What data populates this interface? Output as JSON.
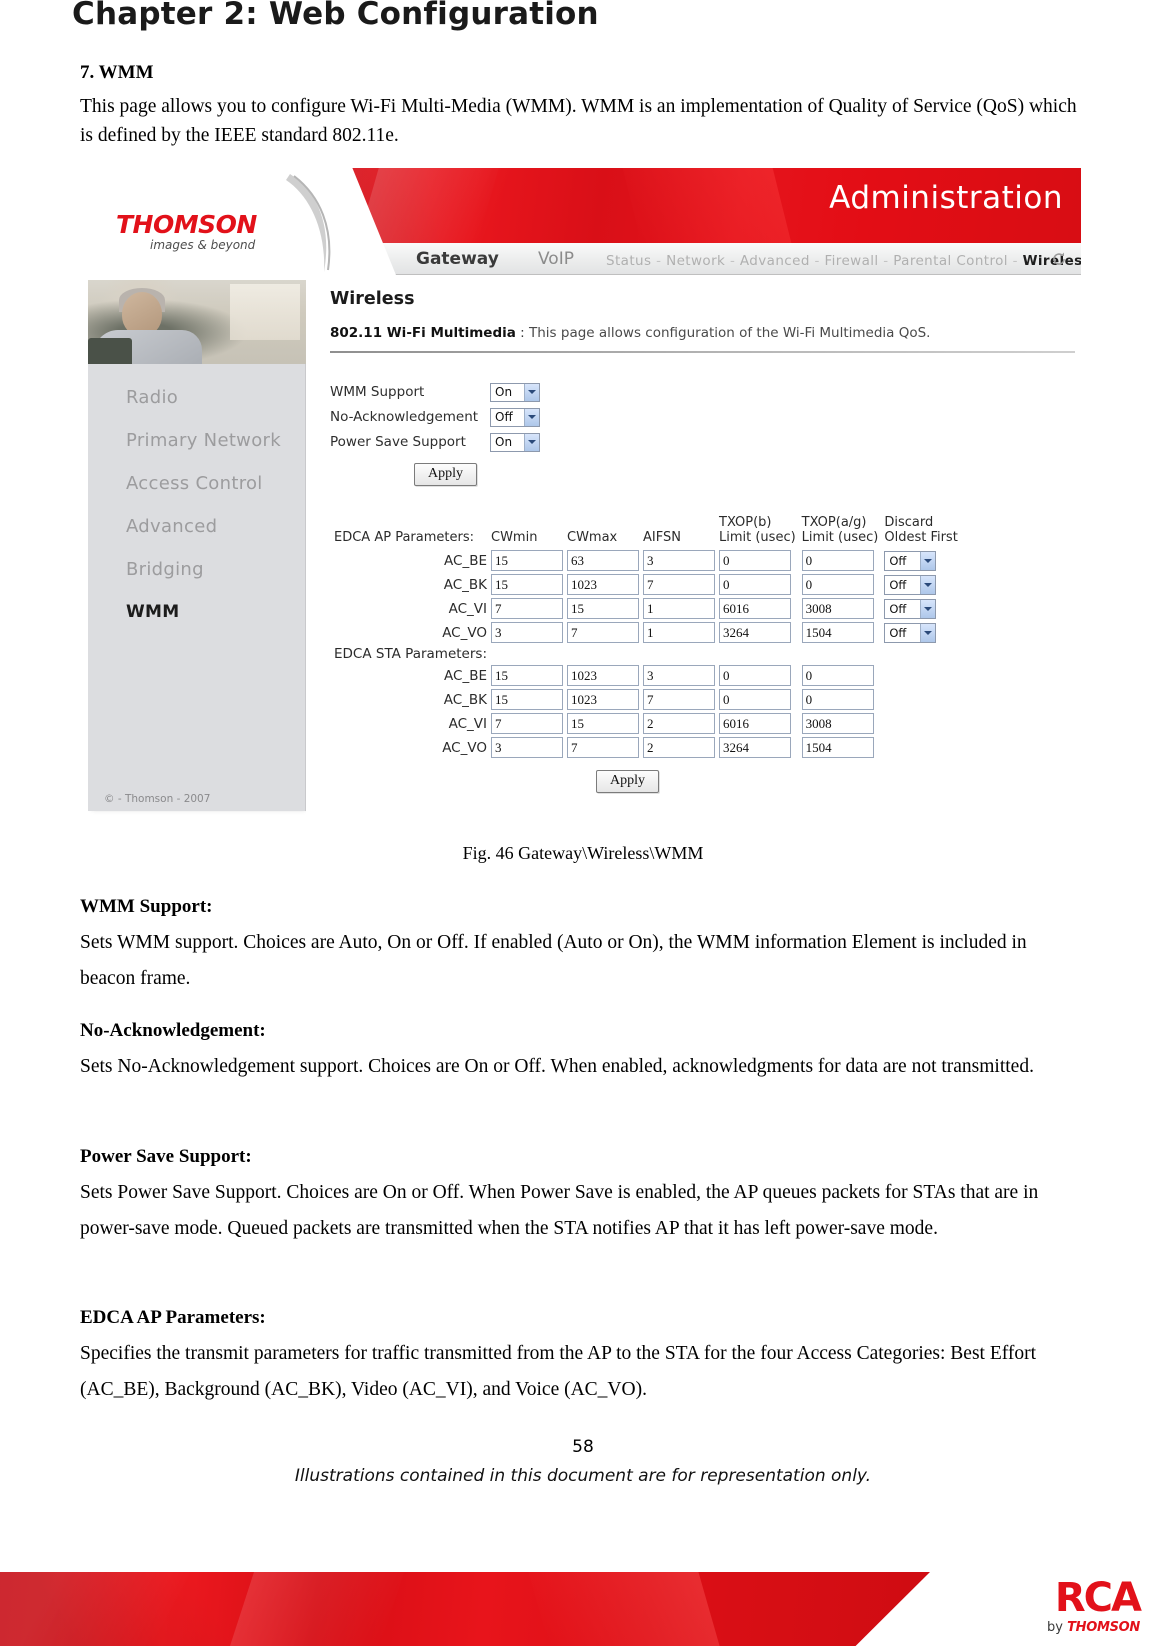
{
  "document": {
    "chapter_title": "Chapter 2: Web Configuration",
    "section_heading": "7. WMM",
    "intro": "This page allows you to configure Wi-Fi Multi-Media (WMM). WMM is an implementation of Quality of Service (QoS) which is defined by the IEEE standard 802.11e.",
    "figure_caption": "Fig. 46 Gateway\\Wireless\\WMM",
    "page_number": "58",
    "footer_note": "Illustrations contained in this document are for representation only."
  },
  "brand": {
    "logo_text": "THOMSON",
    "logo_tagline": "images & beyond",
    "footer_logo": "RCA",
    "footer_logo_by": "by",
    "footer_logo_by_brand": "THOMSON",
    "accent_red": "#e2121b"
  },
  "screenshot": {
    "banner_title": "Administration",
    "nav": {
      "primary": [
        "Gateway",
        "VoIP"
      ],
      "secondary": [
        "Status",
        "Network",
        "Advanced",
        "Firewall",
        "Parental Control",
        "Wireless"
      ],
      "active_secondary": "Wireless",
      "refresh_icon": "refresh-icon"
    },
    "sidebar": {
      "items": [
        "Radio",
        "Primary Network",
        "Access Control",
        "Advanced",
        "Bridging",
        "WMM"
      ],
      "active": "WMM",
      "copyright": "© - Thomson - 2007"
    },
    "pane": {
      "title": "Wireless",
      "subtitle_bold": "802.11 Wi-Fi Multimedia",
      "subtitle_sep": ":",
      "subtitle_desc": "This page allows configuration of the Wi-Fi Multimedia QoS."
    },
    "form": {
      "rows": [
        {
          "label": "WMM Support",
          "value": "On"
        },
        {
          "label": "No-Acknowledgement",
          "value": "Off"
        },
        {
          "label": "Power Save Support",
          "value": "On"
        }
      ],
      "apply_label": "Apply"
    },
    "edca": {
      "ap_title": "EDCA AP Parameters:",
      "sta_title": "EDCA STA Parameters:",
      "headers": [
        "CWmin",
        "CWmax",
        "AIFSN",
        "TXOP(b)\nLimit (usec)",
        "TXOP(a/g)\nLimit (usec)",
        "Discard\nOldest First"
      ],
      "headers_flat": {
        "cwmin": "CWmin",
        "cwmax": "CWmax",
        "aifsn": "AIFSN",
        "txop_b_l1": "TXOP(b)",
        "txop_b_l2": "Limit (usec)",
        "txop_ag_l1": "TXOP(a/g)",
        "txop_ag_l2": "Limit (usec)",
        "discard_l1": "Discard",
        "discard_l2": "Oldest First"
      },
      "ap_rows": [
        {
          "ac": "AC_BE",
          "cwmin": "15",
          "cwmax": "63",
          "aifsn": "3",
          "txop_b": "0",
          "txop_ag": "0",
          "discard": "Off"
        },
        {
          "ac": "AC_BK",
          "cwmin": "15",
          "cwmax": "1023",
          "aifsn": "7",
          "txop_b": "0",
          "txop_ag": "0",
          "discard": "Off"
        },
        {
          "ac": "AC_VI",
          "cwmin": "7",
          "cwmax": "15",
          "aifsn": "1",
          "txop_b": "6016",
          "txop_ag": "3008",
          "discard": "Off"
        },
        {
          "ac": "AC_VO",
          "cwmin": "3",
          "cwmax": "7",
          "aifsn": "1",
          "txop_b": "3264",
          "txop_ag": "1504",
          "discard": "Off"
        }
      ],
      "sta_rows": [
        {
          "ac": "AC_BE",
          "cwmin": "15",
          "cwmax": "1023",
          "aifsn": "3",
          "txop_b": "0",
          "txop_ag": "0"
        },
        {
          "ac": "AC_BK",
          "cwmin": "15",
          "cwmax": "1023",
          "aifsn": "7",
          "txop_b": "0",
          "txop_ag": "0"
        },
        {
          "ac": "AC_VI",
          "cwmin": "7",
          "cwmax": "15",
          "aifsn": "2",
          "txop_b": "6016",
          "txop_ag": "3008"
        },
        {
          "ac": "AC_VO",
          "cwmin": "3",
          "cwmax": "7",
          "aifsn": "2",
          "txop_b": "3264",
          "txop_ag": "1504"
        }
      ],
      "apply_label": "Apply"
    }
  },
  "descriptions": [
    {
      "heading": "WMM Support:",
      "body": "Sets WMM support. Choices are Auto, On or Off. If enabled (Auto or On), the WMM information Element is included in beacon frame."
    },
    {
      "heading": "No-Acknowledgement:",
      "body": "Sets No-Acknowledgement support. Choices are On or Off. When enabled, acknowledgments for data are not transmitted."
    },
    {
      "heading": "Power Save Support:",
      "body": "Sets Power Save Support. Choices are On or Off. When Power Save is enabled, the AP queues packets for STAs that are in power-save mode. Queued packets are transmitted when the STA notifies AP that it has left power-save mode."
    },
    {
      "heading": "EDCA AP Parameters:",
      "body": "Specifies the transmit parameters for traffic transmitted from the AP to the STA for the four Access Categories: Best Effort (AC_BE), Background (AC_BK), Video (AC_VI), and Voice (AC_VO)."
    }
  ]
}
